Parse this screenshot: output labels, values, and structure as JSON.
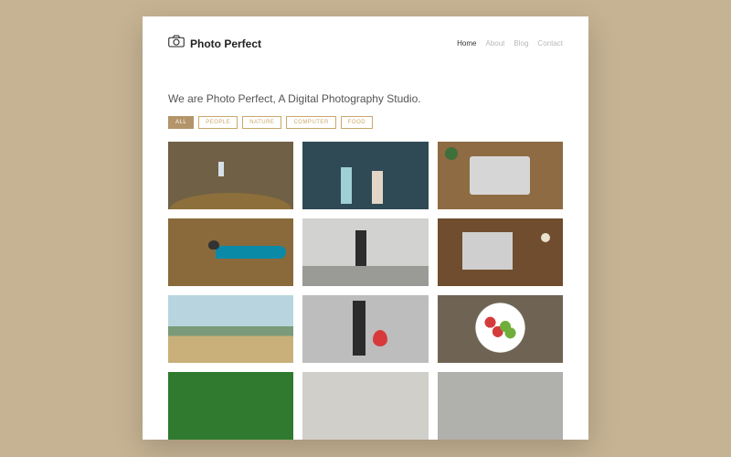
{
  "brand": {
    "name": "Photo Perfect"
  },
  "nav": {
    "items": [
      {
        "label": "Home",
        "active": true
      },
      {
        "label": "About",
        "active": false
      },
      {
        "label": "Blog",
        "active": false
      },
      {
        "label": "Contact",
        "active": false
      }
    ]
  },
  "headline": "We are Photo Perfect, A Digital Photography Studio.",
  "filters": [
    {
      "label": "ALL",
      "active": true
    },
    {
      "label": "PEOPLE",
      "active": false
    },
    {
      "label": "NATURE",
      "active": false
    },
    {
      "label": "COMPUTER",
      "active": false
    },
    {
      "label": "FOOD",
      "active": false
    }
  ],
  "gallery": {
    "items": [
      {
        "name": "forest-walk"
      },
      {
        "name": "kids-wall"
      },
      {
        "name": "desk-laptop-topdown"
      },
      {
        "name": "bird-on-hand"
      },
      {
        "name": "street-photographer"
      },
      {
        "name": "laptop-coffee-desk"
      },
      {
        "name": "beach-person"
      },
      {
        "name": "girl-red-balloon"
      },
      {
        "name": "fruit-heart-bowl"
      },
      {
        "name": "green-forest"
      },
      {
        "name": "partial-1"
      },
      {
        "name": "partial-2"
      }
    ]
  },
  "colors": {
    "accent": "#b4946a",
    "accent_border": "#c9a86a",
    "page_bg": "#c6b393"
  }
}
